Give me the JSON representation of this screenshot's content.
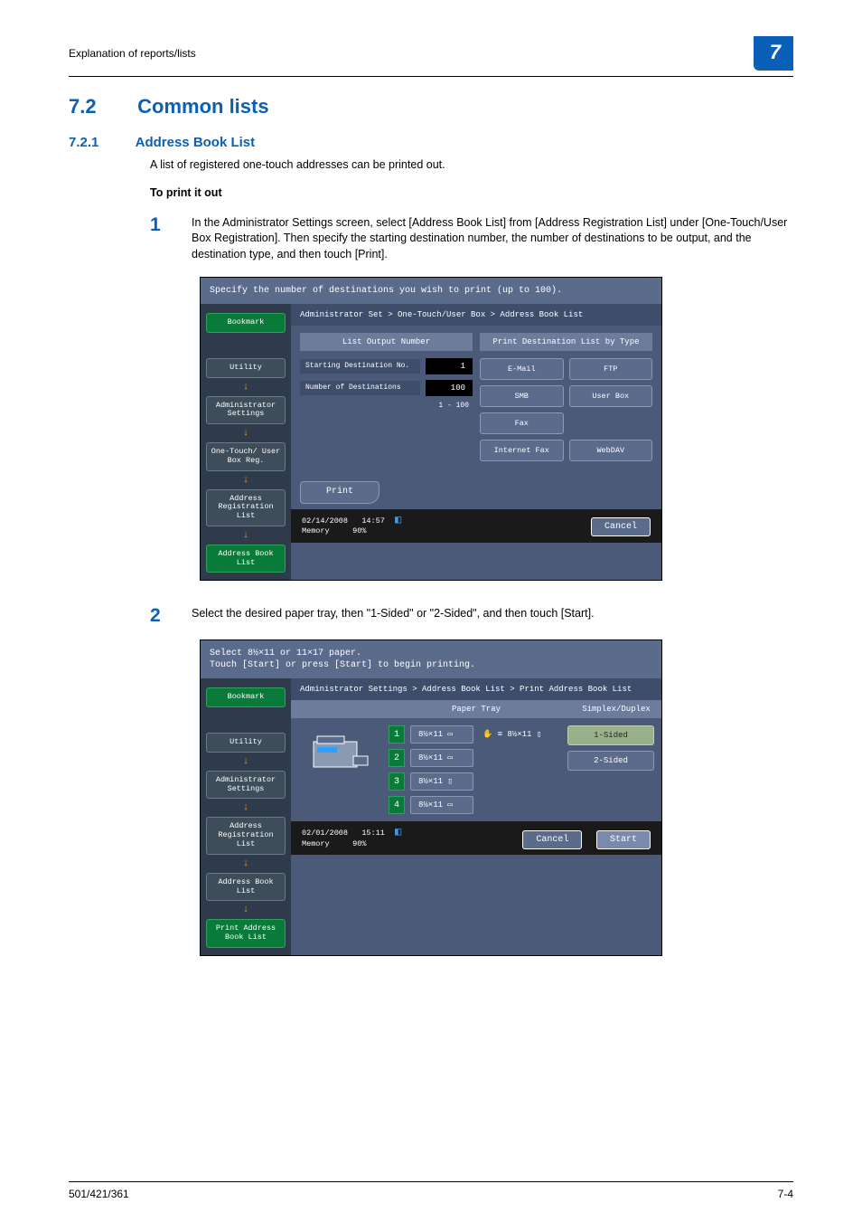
{
  "header": {
    "breadcrumb": "Explanation of reports/lists",
    "chapter": "7"
  },
  "sec": {
    "num": "7.2",
    "title": "Common lists",
    "sub_num": "7.2.1",
    "sub_title": "Address Book List",
    "intro": "A list of registered one-touch addresses can be printed out.",
    "to_print": "To print it out"
  },
  "steps": {
    "s1_num": "1",
    "s1_text": "In the Administrator Settings screen, select [Address Book List] from [Address Registration List] under [One-Touch/User Box Registration]. Then specify the starting destination number, the number of destinations to be output, and the destination type, and then touch [Print].",
    "s2_num": "2",
    "s2_text": "Select the desired paper tray, then \"1-Sided\" or \"2-Sided\", and then touch [Start]."
  },
  "screen1": {
    "topmsg": "Specify the number of destinations you wish to print (up to 100).",
    "bookmark": "Bookmark",
    "side": {
      "utility": "Utility",
      "admin": "Administrator\nSettings",
      "onebox": "One-Touch/\nUser Box Reg.",
      "addrreg": "Address\nRegistration\nList",
      "addrbook": "Address Book\nList"
    },
    "breadcrumb": "Administrator Set > One-Touch/User Box > Address Book List",
    "col1_head": "List Output Number",
    "col2_head": "Print Destination List by Type",
    "start_lbl": "Starting\nDestination No.",
    "start_val": "1",
    "num_lbl": "Number of\nDestinations",
    "num_val": "100",
    "range": "1  -  100",
    "types": {
      "email": "E-Mail",
      "ftp": "FTP",
      "smb": "SMB",
      "userbox": "User Box",
      "fax": "Fax",
      "ifax": "Internet Fax",
      "webdav": "WebDAV"
    },
    "print": "Print",
    "footer_date": "02/14/2008",
    "footer_time": "14:57",
    "footer_mem": "Memory",
    "footer_pct": "90%",
    "cancel": "Cancel"
  },
  "screen2": {
    "topmsg": "Select 8½×11 or 11×17 paper.\nTouch [Start] or press [Start] to begin printing.",
    "bookmark": "Bookmark",
    "side": {
      "utility": "Utility",
      "admin": "Administrator\nSettings",
      "addrreg": "Address\nRegistration\nList",
      "addrbook": "Address Book\nList",
      "printaddr": "Print Address\nBook List"
    },
    "breadcrumb": "Administrator Settings > Address Book List > Print Address Book List",
    "th_paper": "Paper Tray",
    "th_sd": "Simplex/Duplex",
    "trays": {
      "t1": {
        "num": "1",
        "size": "8½×11 ▭"
      },
      "t2": {
        "num": "2",
        "size": "8½×11 ▭"
      },
      "t3": {
        "num": "3",
        "size": "8½×11 ▯"
      },
      "t4": {
        "num": "4",
        "size": "8½×11 ▭"
      },
      "bypass": "✋ ≡ 8½×11 ▯"
    },
    "sd": {
      "one": "1-Sided",
      "two": "2-Sided"
    },
    "footer_date": "02/01/2008",
    "footer_time": "15:11",
    "footer_mem": "Memory",
    "footer_pct": "90%",
    "cancel": "Cancel",
    "start": "Start"
  },
  "footer": {
    "model": "501/421/361",
    "page": "7-4"
  }
}
